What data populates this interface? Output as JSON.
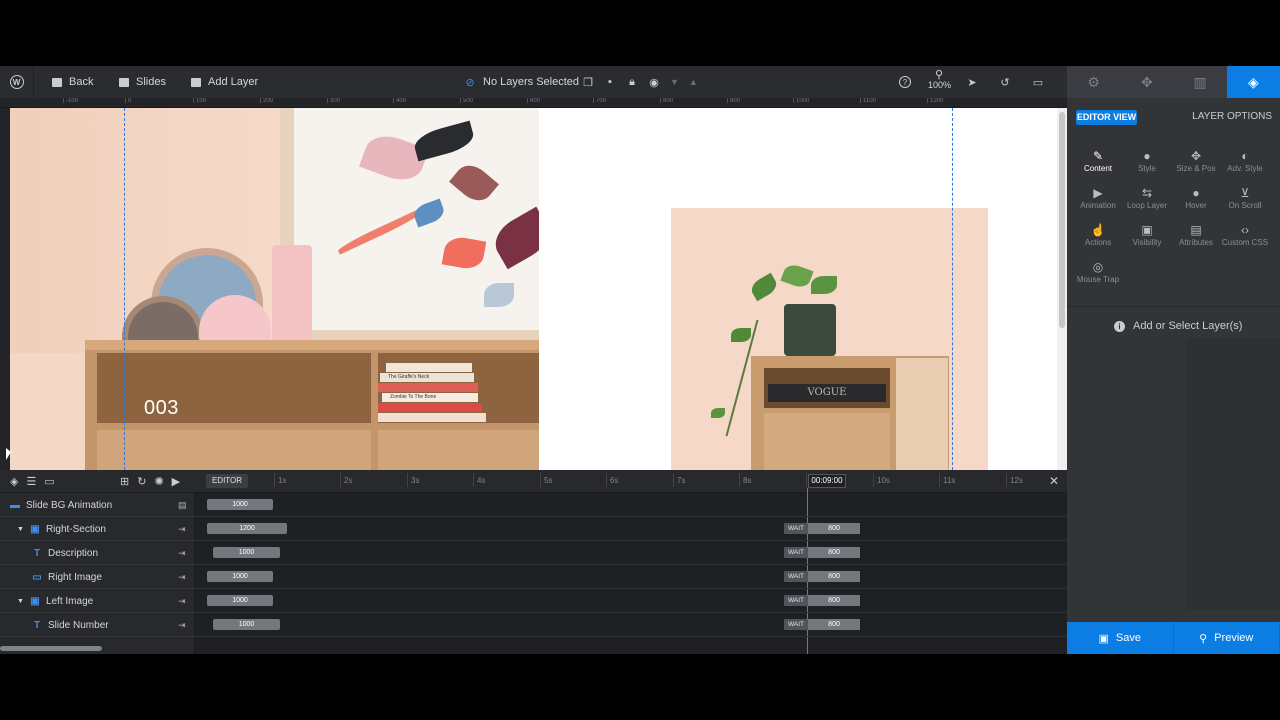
{
  "toolbar": {
    "back_label": "Back",
    "slides_label": "Slides",
    "add_layer_label": "Add Layer",
    "selection_label": "No Layers Selected",
    "zoom_label": "100%"
  },
  "right_panel": {
    "editor_view_label": "EDITOR VIEW",
    "layer_options_label": "LAYER OPTIONS",
    "options": [
      {
        "label": "Content",
        "icon": "pen-icon"
      },
      {
        "label": "Style",
        "icon": "palette-icon"
      },
      {
        "label": "Size & Pos",
        "icon": "move-icon"
      },
      {
        "label": "Adv. Style",
        "icon": "contrast-icon"
      },
      {
        "label": "Animation",
        "icon": "play-icon"
      },
      {
        "label": "Loop Layer",
        "icon": "loop-icon"
      },
      {
        "label": "Hover",
        "icon": "mouse-icon"
      },
      {
        "label": "On Scroll",
        "icon": "scroll-icon"
      },
      {
        "label": "Actions",
        "icon": "hand-icon"
      },
      {
        "label": "Visibility",
        "icon": "visibility-icon"
      },
      {
        "label": "Attributes",
        "icon": "document-icon"
      },
      {
        "label": "Custom CSS",
        "icon": "code-icon"
      },
      {
        "label": "Mouse Trap",
        "icon": "target-icon"
      }
    ],
    "empty_message": "Add or Select Layer(s)",
    "save_label": "Save",
    "preview_label": "Preview"
  },
  "ruler": {
    "ticks": [
      "-100",
      "0",
      "100",
      "200",
      "300",
      "400",
      "500",
      "600",
      "700",
      "800",
      "900",
      "1000",
      "1100",
      "1200"
    ]
  },
  "stage": {
    "slide_number": "003",
    "books": [
      "The Giraffe's Neck",
      "Zombie To The Bone"
    ],
    "magazine": "VOGUE"
  },
  "timeline": {
    "editor_label": "EDITOR",
    "current_time": "00:09:00",
    "ticks": [
      "1s",
      "2s",
      "3s",
      "4s",
      "5s",
      "6s",
      "7s",
      "8s",
      "9s",
      "10s",
      "11s",
      "12s"
    ],
    "rows": [
      {
        "name": "Slide BG Animation",
        "start": "1000",
        "wait": "",
        "end": ""
      },
      {
        "name": "Right-Section",
        "start": "1200",
        "wait": "WAIT",
        "end": "800"
      },
      {
        "name": "Description",
        "start": "1000",
        "wait": "WAIT",
        "end": "800"
      },
      {
        "name": "Right Image",
        "start": "1000",
        "wait": "WAIT",
        "end": "800"
      },
      {
        "name": "Left Image",
        "start": "1000",
        "wait": "WAIT",
        "end": "800"
      },
      {
        "name": "Slide Number",
        "start": "1000",
        "wait": "WAIT",
        "end": "800"
      }
    ]
  },
  "colors": {
    "accent": "#0b7de3",
    "panel": "#2a2c30",
    "timeline_bg": "#1f2023"
  }
}
